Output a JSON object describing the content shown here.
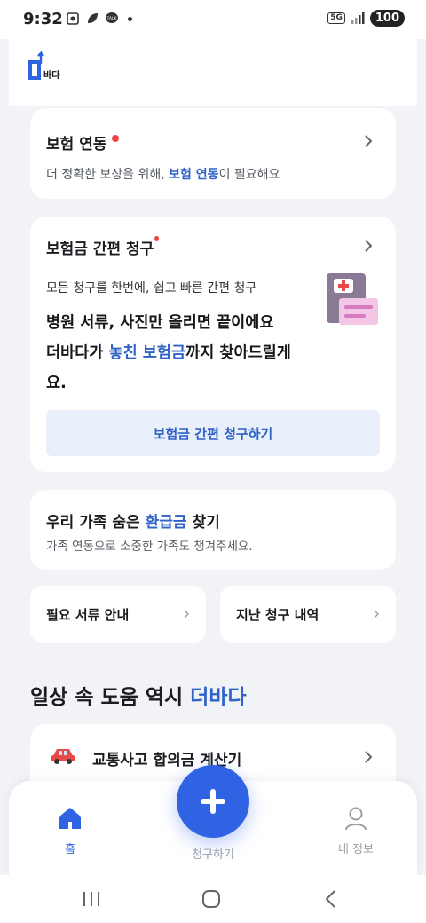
{
  "status_bar": {
    "time": "9:32",
    "network": "5G",
    "battery": "100"
  },
  "app": {
    "logo_text": "바다"
  },
  "insurance_link": {
    "title": "보험 연동",
    "desc_before": "더 정확한 보상을 위해, ",
    "desc_highlight": "보험 연동",
    "desc_after": "이 필요해요"
  },
  "quick_claim": {
    "title": "보험금 간편 청구",
    "desc": "모든 청구를 한번에, 쉽고 빠른 간편 청구",
    "line1": "병원 서류, 사진만 올리면 끝이에요",
    "line2_before": "더바다가 ",
    "line2_highlight": "놓친 보험금",
    "line2_after": "까지 찾아드릴게",
    "line3": "요.",
    "cta_label": "보험금 간편 청구하기"
  },
  "family_refund": {
    "title_before": "우리 가족 숨은 ",
    "title_highlight": "환급금",
    "title_after": " 찾기",
    "desc": "가족 연동으로 소중한 가족도 챙겨주세요."
  },
  "shortcuts": [
    {
      "label": "필요 서류 안내"
    },
    {
      "label": "지난 청구 내역"
    }
  ],
  "daily_section": {
    "title_before": "일상 속 도움 역시 ",
    "title_highlight": "더바다"
  },
  "accident_card": {
    "title": "교통사고 합의금 계산기"
  },
  "bottom_nav": {
    "home": "홈",
    "claim": "청구하기",
    "my_info": "내 정보"
  },
  "colors": {
    "accent": "#2f63c8",
    "fab": "#2f63e4",
    "alert": "#ee4444",
    "background": "#f2f3f6"
  }
}
